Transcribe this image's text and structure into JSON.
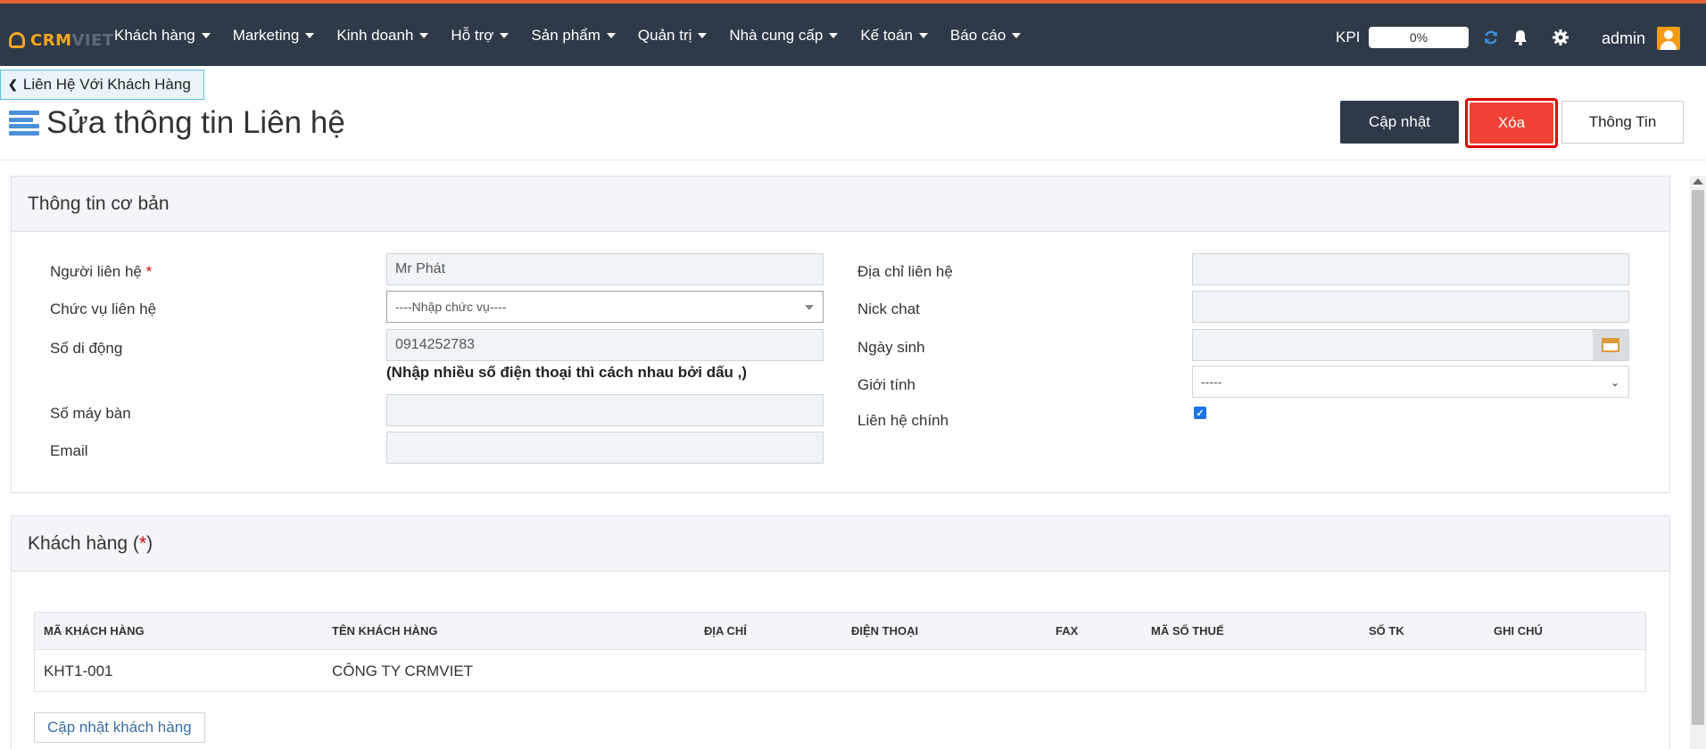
{
  "app": {
    "logo_main": "CRM",
    "logo_sub": "VIET"
  },
  "nav": {
    "items": [
      {
        "label": "Khách hàng"
      },
      {
        "label": "Marketing"
      },
      {
        "label": "Kinh doanh"
      },
      {
        "label": "Hỗ trợ"
      },
      {
        "label": "Sản phẩm"
      },
      {
        "label": "Quản trị"
      },
      {
        "label": "Nhà cung cấp"
      },
      {
        "label": "Kế toán"
      },
      {
        "label": "Báo cáo"
      }
    ],
    "kpi_label": "KPI",
    "kpi_value": "0%",
    "user": "admin"
  },
  "back_link": "Liên Hệ Với Khách Hàng",
  "page_title": "Sửa thông tin Liên hệ",
  "actions": {
    "update": "Cập nhật",
    "delete": "Xóa",
    "info": "Thông Tin"
  },
  "basic": {
    "heading": "Thông tin cơ bản",
    "contact_person_label": "Người liên hệ",
    "required_mark": "*",
    "contact_person_value": "Mr Phát",
    "position_label": "Chức vụ liên hệ",
    "position_value": "----Nhập chức vụ----",
    "mobile_label": "Số di động",
    "mobile_value": "0914252783",
    "mobile_hint": "(Nhập nhiều số điện thoại thì cách nhau bởi dấu ,)",
    "desk_phone_label": "Số máy bàn",
    "desk_phone_value": "",
    "email_label": "Email",
    "email_value": "",
    "address_label": "Địa chỉ liên hệ",
    "address_value": "",
    "nick_label": "Nick chat",
    "nick_value": "",
    "birthday_label": "Ngày sinh",
    "birthday_value": "",
    "gender_label": "Giới tính",
    "gender_value": "-----",
    "primary_label": "Liên hệ chính",
    "primary_checked": true
  },
  "customers": {
    "heading_prefix": "Khách hàng (",
    "heading_mark": "*",
    "heading_suffix": ")",
    "columns": [
      "Mã khách hàng",
      "Tên khách hàng",
      "Địa chỉ",
      "Điện thoại",
      "Fax",
      "Mã số thuế",
      "Số TK",
      "Ghi chú"
    ],
    "rows": [
      [
        "KHT1-001",
        "CÔNG TY CRMVIET",
        "",
        "",
        "",
        "",
        "",
        ""
      ]
    ],
    "update_button": "Cập nhật khách hàng"
  },
  "colors": {
    "topbar": "#2e3a48",
    "accent": "#f04134",
    "primary_btn": "#2e3a48",
    "logo": "#f5a623"
  }
}
